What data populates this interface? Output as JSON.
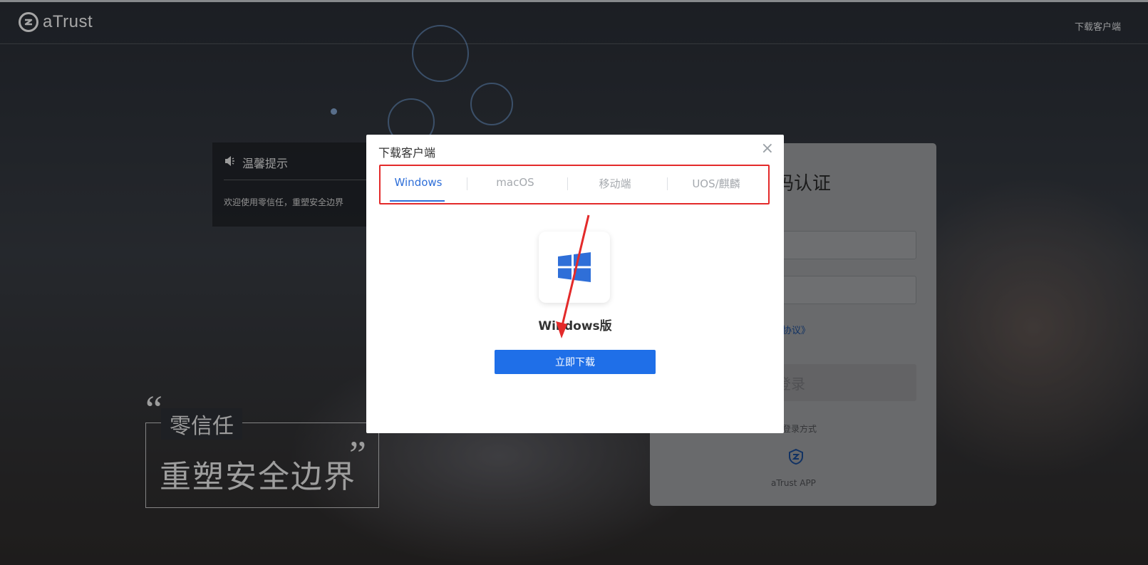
{
  "header": {
    "brand_name": "aTrust",
    "download_link": "下载客户端"
  },
  "notice": {
    "title": "温馨提示",
    "text": "欢迎使用零信任，重塑安全边界"
  },
  "slogan": {
    "small": "零信任",
    "big": "重塑安全边界",
    "quote_open": "“",
    "quote_close": "”"
  },
  "login": {
    "title": "密码认证",
    "agreement": "协议》",
    "submit": "登录",
    "other_methods": "登录方式",
    "app_label": "aTrust APP"
  },
  "modal": {
    "title": "下载客户端",
    "close": "×",
    "tabs": [
      "Windows",
      "macOS",
      "移动端",
      "UOS/麒麟"
    ],
    "active_tab": "Windows",
    "os_name": "Windows版",
    "download_button": "立即下载"
  },
  "colors": {
    "accent": "#1f6fe8",
    "tab_active": "#2f6fd8",
    "highlight": "#e32a2a"
  }
}
